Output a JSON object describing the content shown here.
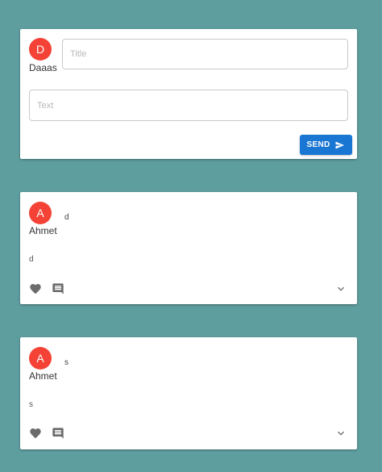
{
  "compose": {
    "avatar_letter": "D",
    "username": "Daaas",
    "title_placeholder": "Title",
    "text_placeholder": "Text",
    "send_label": "SEND"
  },
  "posts": [
    {
      "avatar_letter": "A",
      "username": "Ahmet",
      "title": "d",
      "body": "d"
    },
    {
      "avatar_letter": "A",
      "username": "Ahmet",
      "title": "s",
      "body": "s"
    }
  ],
  "colors": {
    "background": "#5f9e9f",
    "avatar": "#f44336",
    "send_button": "#1976d2",
    "icon": "#6b6b6b"
  },
  "icons": {
    "send": "send-icon",
    "like": "heart-icon",
    "comment": "comment-icon",
    "expand": "chevron-down-icon"
  }
}
